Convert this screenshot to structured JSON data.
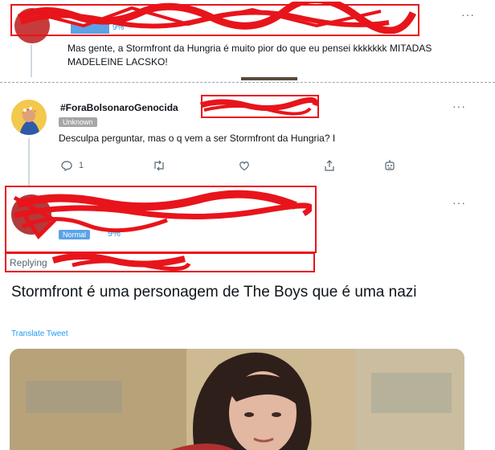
{
  "tweet_top": {
    "pct": "9%",
    "text": "Mas gente, a Stormfront da Hungria é muito pior do que eu pensei kkkkkkk MITADAS MADELEINE LACSKO!"
  },
  "tweet_mid": {
    "author": "#ForaBolsonaroGenocida",
    "badge": "Unknown",
    "text": "Desculpa perguntar, mas o q vem a ser Stormfront da Hungria? I",
    "reply_count": "1"
  },
  "tweet_main": {
    "badge": "Normal",
    "pct": "9%",
    "replying_prefix": "Replying",
    "text": "Stormfront é uma personagem de The Boys que é uma nazi",
    "translate": "Translate Tweet"
  },
  "more_label": "···",
  "colors": {
    "accent": "#1d9bf0",
    "badge_unknown": "#a6a6a6",
    "badge_normal": "#5ba3e6",
    "redact": "#e8141b"
  }
}
